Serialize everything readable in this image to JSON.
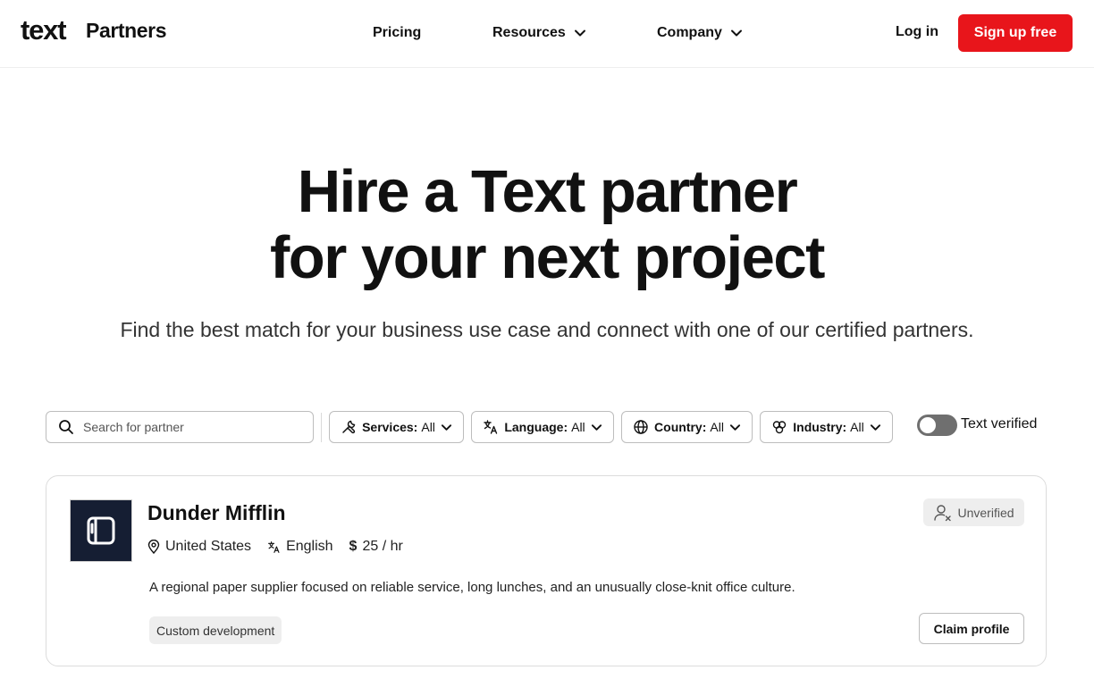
{
  "header": {
    "logo": "text",
    "logo_sub": "Partners",
    "nav": [
      {
        "label": "Pricing"
      },
      {
        "label": "Resources",
        "icon": "chevron-down-icon"
      },
      {
        "label": "Company",
        "icon": "chevron-down-icon"
      }
    ],
    "login_label": "Log in",
    "signup_label": "Sign up free",
    "signup_color": "#e8151b"
  },
  "hero": {
    "title_line1": "Hire a Text partner",
    "title_line2": "for your next project",
    "subtitle": "Find the best match for your business use case and connect with one of our certified partners."
  },
  "filters": {
    "search_placeholder": "Search for partner",
    "services": {
      "label": "Services:",
      "value": "All",
      "icon": "tools-icon"
    },
    "language": {
      "label": "Language:",
      "value": "All",
      "icon": "translate-icon"
    },
    "country": {
      "label": "Country:",
      "value": "All",
      "icon": "globe-icon"
    },
    "industry": {
      "label": "Industry:",
      "value": "All",
      "icon": "industry-icon"
    },
    "verified_label": "Text verified",
    "verified_on": false
  },
  "partners": [
    {
      "name": "Dunder Mifflin",
      "country": "United States",
      "language": "English",
      "rate": "25 / hr",
      "description": "A regional paper supplier focused on reliable service, long lunches, and an unusually close-knit office culture.",
      "tags": [
        "Custom development"
      ],
      "status": "Unverified",
      "claim_label": "Claim profile",
      "avatar_bg": "#151e33"
    }
  ]
}
